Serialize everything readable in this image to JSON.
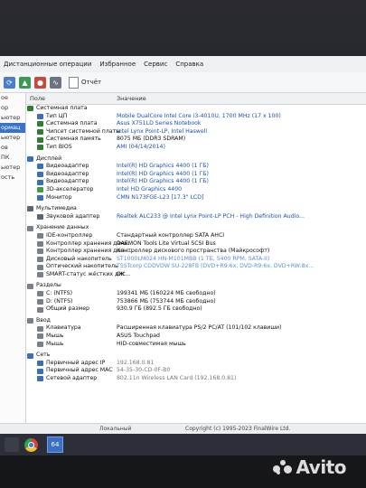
{
  "menu": [
    "Дистанционные операции",
    "Избранное",
    "Сервис",
    "Справка"
  ],
  "toolbar": {
    "report_label": "Отчёт"
  },
  "sidebar": {
    "items": [
      "ое",
      "ор",
      "ьютер",
      "ормац",
      "ьютер",
      "ов",
      "ПК",
      "ьютер",
      "ость",
      "",
      "",
      "",
      "",
      "",
      "",
      ""
    ]
  },
  "columns": {
    "field": "Поле",
    "value": "Значение"
  },
  "sections": [
    {
      "title": "Системная плата",
      "icon_color": "#2f7d32",
      "items": [
        {
          "label": "Тип ЦП",
          "value": "Mobile DualCore Intel Core i3-4010U, 1700 MHz (17 x 100)",
          "icon": "#3c6fb6",
          "style": "link"
        },
        {
          "label": "Системная плата",
          "value": "Asus X751LD Series Notebook",
          "icon": "#2f7d32",
          "style": "link"
        },
        {
          "label": "Чипсет системной платы",
          "value": "Intel Lynx Point-LP, Intel Haswell",
          "icon": "#2f7d32",
          "style": "link"
        },
        {
          "label": "Системная память",
          "value": "8075 МБ  (DDR3 SDRAM)",
          "icon": "#2f7d32",
          "style": ""
        },
        {
          "label": "Тип BIOS",
          "value": "AMI (04/14/2014)",
          "icon": "#2f7d32",
          "style": "link"
        }
      ]
    },
    {
      "title": "Дисплей",
      "icon_color": "#3c6fb6",
      "items": [
        {
          "label": "Видеоадаптер",
          "value": "Intel(R) HD Graphics 4400  (1 ГБ)",
          "icon": "#3c6fb6",
          "style": "link"
        },
        {
          "label": "Видеоадаптер",
          "value": "Intel(R) HD Graphics 4400  (1 ГБ)",
          "icon": "#3c6fb6",
          "style": "link"
        },
        {
          "label": "Видеоадаптер",
          "value": "Intel(R) HD Graphics 4400  (1 ГБ)",
          "icon": "#3c6fb6",
          "style": "link"
        },
        {
          "label": "3D-акселератор",
          "value": "Intel HD Graphics 4400",
          "icon": "#3aa043",
          "style": "link"
        },
        {
          "label": "Монитор",
          "value": "CMN N173FGE-L23  [17.3\" LCD]",
          "icon": "#3c6fb6",
          "style": "link"
        }
      ]
    },
    {
      "title": "Мультимедиа",
      "icon_color": "#5d6670",
      "items": [
        {
          "label": "Звуковой адаптер",
          "value": "Realtek ALC233 @ Intel Lynx Point-LP PCH - High Definition Audio...",
          "icon": "#5d6670",
          "style": "link"
        }
      ]
    },
    {
      "title": "Хранение данных",
      "icon_color": "#7a7f88",
      "items": [
        {
          "label": "IDE-контроллер",
          "value": "Стандартный контроллер SATA AHCI",
          "icon": "#7a7f88",
          "style": ""
        },
        {
          "label": "Контроллер хранения данн...",
          "value": "DAEMON Tools Lite Virtual SCSI Bus",
          "icon": "#7a7f88",
          "style": ""
        },
        {
          "label": "Контроллер хранения данн...",
          "value": "Контроллер дискового пространства (Майкрософт)",
          "icon": "#7a7f88",
          "style": ""
        },
        {
          "label": "Дисковый накопитель",
          "value": "ST1000LM024 HN-M101MBB  (1 ТБ, 5400 RPM, SATA-II)",
          "icon": "#7a7f88",
          "style": "faded"
        },
        {
          "label": "Оптический накопитель",
          "value": "TSSTcorp CDDVDW SU-228FB  (DVD+R9:6x, DVD-R9:6x, DVD+RW:8x...",
          "icon": "#7a7f88",
          "style": "faded"
        },
        {
          "label": "SMART-статус жёстких дис...",
          "value": "OK",
          "icon": "#7a7f88",
          "style": ""
        }
      ]
    },
    {
      "title": "Разделы",
      "icon_color": "#7a7f88",
      "items": [
        {
          "label": "C: (NTFS)",
          "value": "199341 МБ (160224 МБ свободно)",
          "icon": "#7a7f88",
          "style": ""
        },
        {
          "label": "D: (NTFS)",
          "value": "753866 МБ (753744 МБ свободно)",
          "icon": "#7a7f88",
          "style": ""
        },
        {
          "label": "Общий размер",
          "value": "930.9 ГБ (892.5 ГБ свободно)",
          "icon": "#7a7f88",
          "style": ""
        }
      ]
    },
    {
      "title": "Ввод",
      "icon_color": "#7a7f88",
      "items": [
        {
          "label": "Клавиатура",
          "value": "Расширенная клавиатура PS/2 PC/AT (101/102 клавиши)",
          "icon": "#7a7f88",
          "style": ""
        },
        {
          "label": "Мышь",
          "value": "ASUS Touchpad",
          "icon": "#7a7f88",
          "style": ""
        },
        {
          "label": "Мышь",
          "value": "HID-совместимая мышь",
          "icon": "#7a7f88",
          "style": ""
        }
      ]
    },
    {
      "title": "Сеть",
      "icon_color": "#3c6fb6",
      "items": [
        {
          "label": "Первичный адрес IP",
          "value": "192.168.0.81",
          "icon": "#3c6fb6",
          "style": "gray"
        },
        {
          "label": "Первичный адрес MAC",
          "value": "54-35-30-CD-0F-B0",
          "icon": "#3c6fb6",
          "style": "gray"
        },
        {
          "label": "Сетевой адаптер",
          "value": "802.11n Wireless LAN Card  (192.168.0.81)",
          "icon": "#3c6fb6",
          "style": "gray"
        }
      ]
    }
  ],
  "statusbar": {
    "left": "Локальный",
    "right": "Copyright (c) 1995-2023 FinalWire Ltd."
  },
  "taskbar": {
    "app_label": "64"
  },
  "watermark": {
    "text": "Avito"
  }
}
